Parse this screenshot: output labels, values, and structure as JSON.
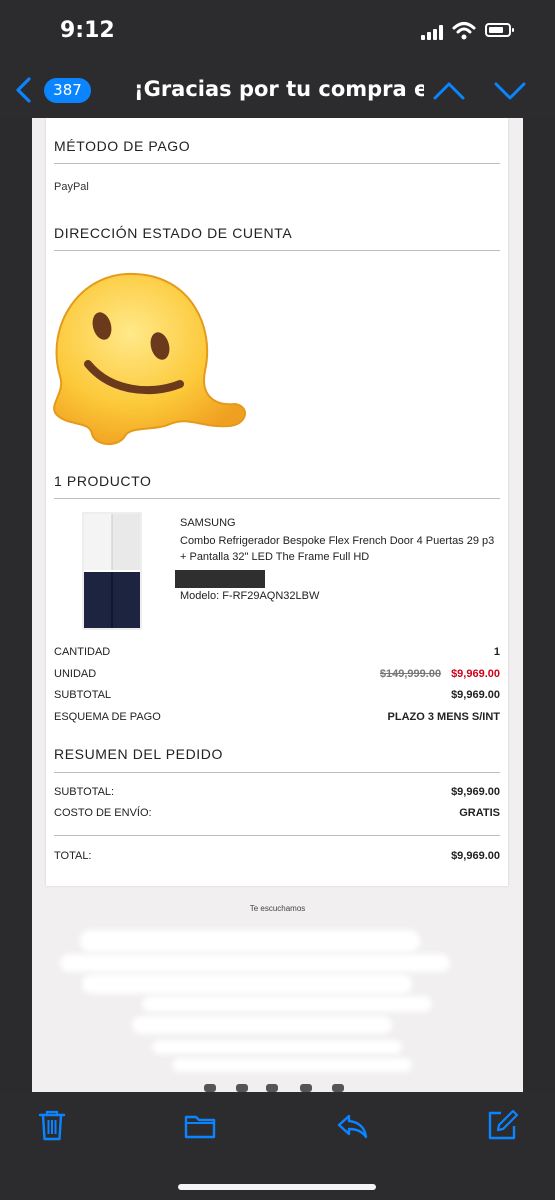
{
  "status_bar": {
    "time": "9:12"
  },
  "nav": {
    "badge_count": "387",
    "subject": "¡Gracias por tu compra en..."
  },
  "email": {
    "payment_section": {
      "title": "MÉTODO DE PAGO",
      "method": "PayPal"
    },
    "address_section": {
      "title": "DIRECCIÓN ESTADO DE CUENTA"
    },
    "product_section": {
      "title": "1 PRODUCTO",
      "brand": "SAMSUNG",
      "name": "Combo Refrigerador Bespoke Flex French Door 4 Puertas 29 p3 + Pantalla 32\" LED The Frame Full HD",
      "model": "Modelo: F-RF29AQN32LBW"
    },
    "details": {
      "quantity_label": "CANTIDAD",
      "quantity_value": "1",
      "unit_label": "UNIDAD",
      "unit_old_price": "$149,999.00",
      "unit_price": "$9,969.00",
      "subtotal_label": "SUBTOTAL",
      "subtotal_value": "$9,969.00",
      "payment_scheme_label": "ESQUEMA DE PAGO",
      "payment_scheme_value": "PLAZO 3 MENS S/INT"
    },
    "summary": {
      "title": "RESUMEN DEL PEDIDO",
      "subtotal_label": "SUBTOTAL:",
      "subtotal_value": "$9,969.00",
      "shipping_label": "COSTO DE ENVÍO:",
      "shipping_value": "GRATIS",
      "total_label": "TOTAL:",
      "total_value": "$9,969.00"
    },
    "footer": {
      "text": "Te escuchamos"
    }
  },
  "colors": {
    "accent": "#0a84ff",
    "sale_price": "#d0021b",
    "bar_background": "#2c2c2e"
  },
  "icons": [
    "back-chevron-icon",
    "up-chevron-icon",
    "down-chevron-icon",
    "trash-icon",
    "folder-icon",
    "reply-icon",
    "compose-icon"
  ]
}
